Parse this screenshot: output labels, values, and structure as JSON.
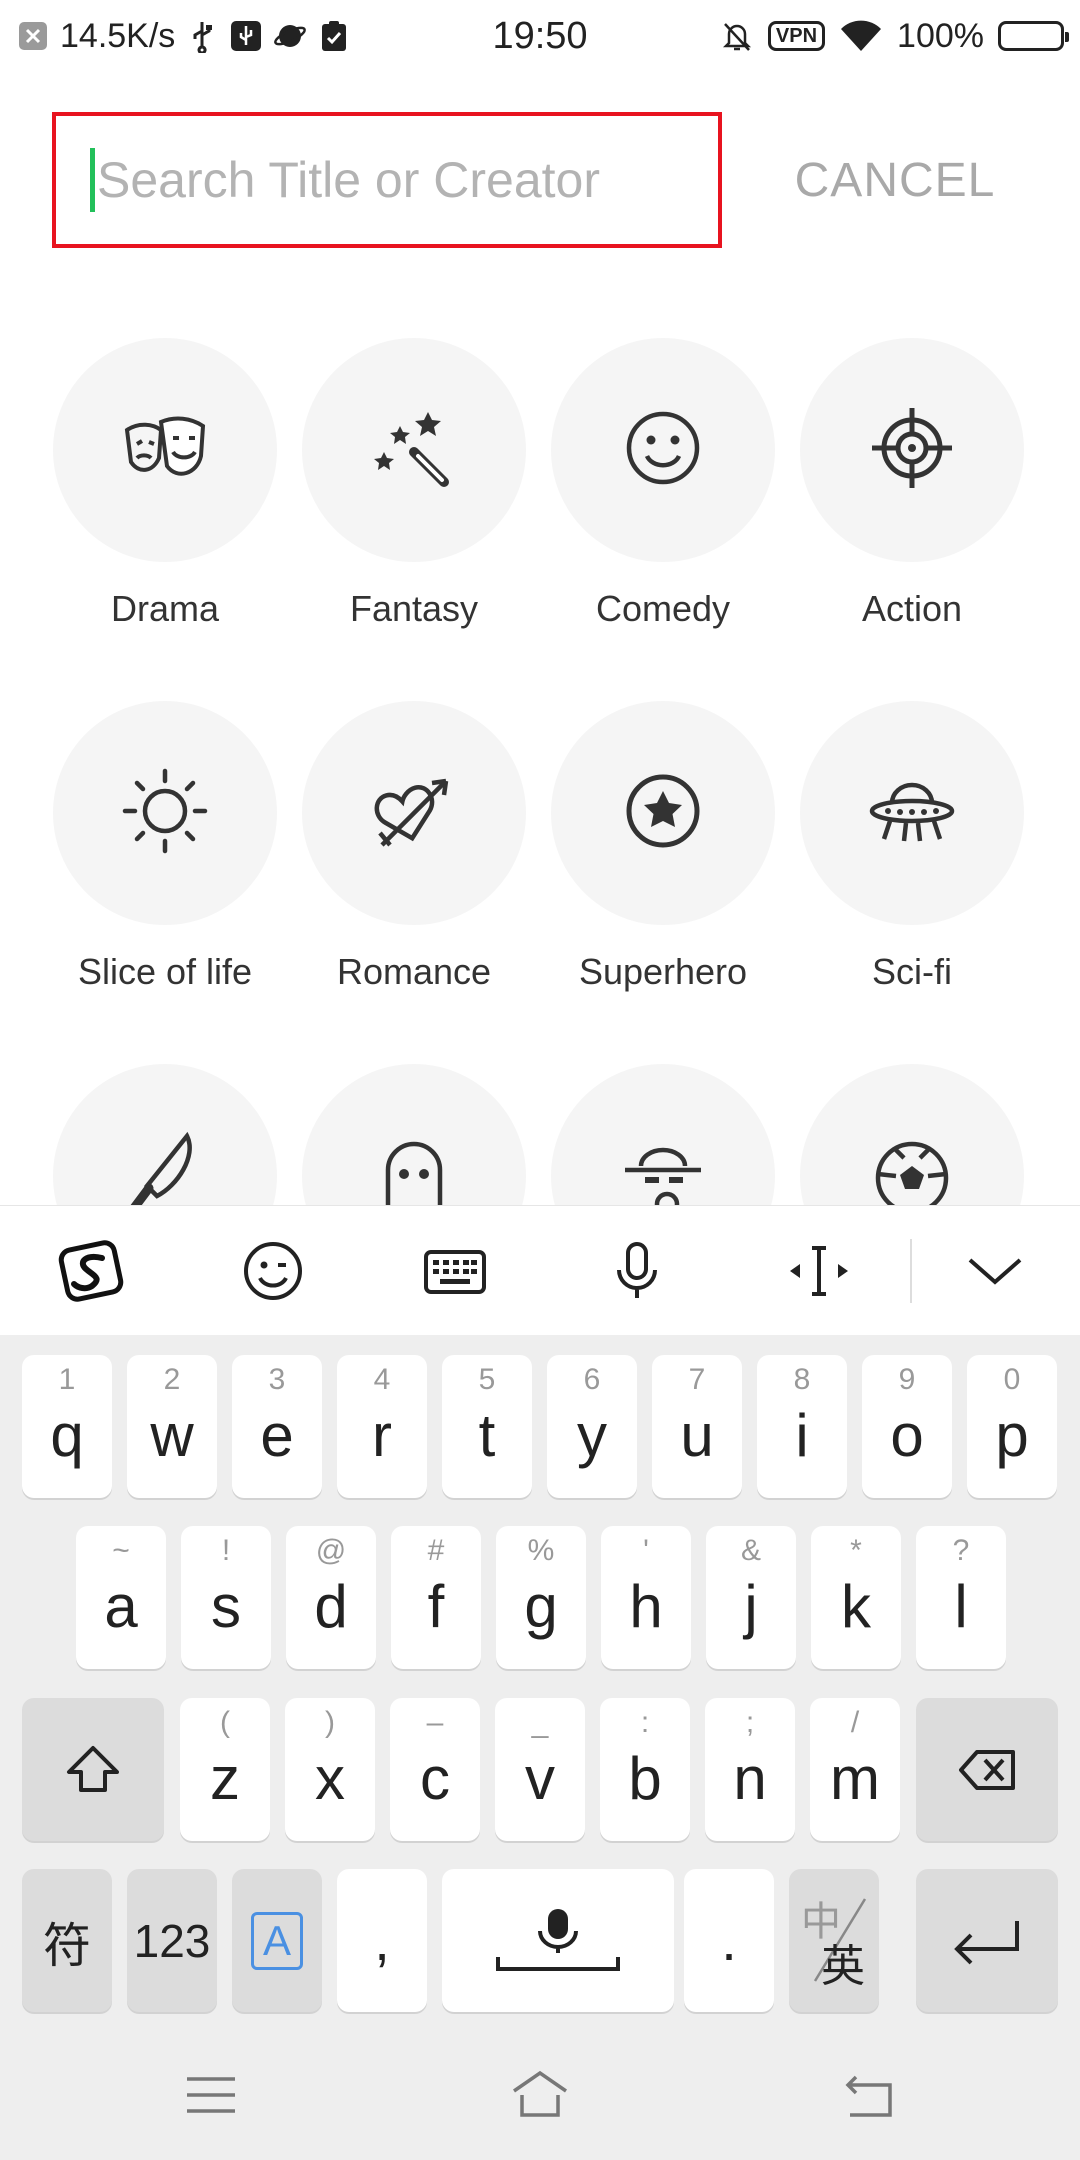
{
  "status_bar": {
    "net_speed": "14.5K/s",
    "time": "19:50",
    "vpn": "VPN",
    "battery": "100%"
  },
  "search": {
    "placeholder": "Search Title or Creator",
    "value": "",
    "cancel_label": "CANCEL"
  },
  "genres": [
    {
      "label": "Drama",
      "icon": "drama-masks-icon"
    },
    {
      "label": "Fantasy",
      "icon": "magic-wand-icon"
    },
    {
      "label": "Comedy",
      "icon": "smiley-icon"
    },
    {
      "label": "Action",
      "icon": "crosshair-icon"
    },
    {
      "label": "Slice of life",
      "icon": "sun-icon"
    },
    {
      "label": "Romance",
      "icon": "heart-arrow-icon"
    },
    {
      "label": "Superhero",
      "icon": "star-badge-icon"
    },
    {
      "label": "Sci-fi",
      "icon": "ufo-icon"
    },
    {
      "label": "",
      "icon": "knife-icon"
    },
    {
      "label": "",
      "icon": "ghost-icon"
    },
    {
      "label": "",
      "icon": "detective-icon"
    },
    {
      "label": "",
      "icon": "soccer-ball-icon"
    }
  ],
  "keyboard": {
    "toolbar": [
      "sogou-logo-icon",
      "emoji-icon",
      "keyboard-icon",
      "microphone-icon",
      "cursor-move-icon",
      "chevron-down-icon"
    ],
    "row1": [
      {
        "hint": "1",
        "key": "q"
      },
      {
        "hint": "2",
        "key": "w"
      },
      {
        "hint": "3",
        "key": "e"
      },
      {
        "hint": "4",
        "key": "r"
      },
      {
        "hint": "5",
        "key": "t"
      },
      {
        "hint": "6",
        "key": "y"
      },
      {
        "hint": "7",
        "key": "u"
      },
      {
        "hint": "8",
        "key": "i"
      },
      {
        "hint": "9",
        "key": "o"
      },
      {
        "hint": "0",
        "key": "p"
      }
    ],
    "row2": [
      {
        "hint": "~",
        "key": "a"
      },
      {
        "hint": "!",
        "key": "s"
      },
      {
        "hint": "@",
        "key": "d"
      },
      {
        "hint": "#",
        "key": "f"
      },
      {
        "hint": "%",
        "key": "g"
      },
      {
        "hint": "'",
        "key": "h"
      },
      {
        "hint": "&",
        "key": "j"
      },
      {
        "hint": "*",
        "key": "k"
      },
      {
        "hint": "?",
        "key": "l"
      }
    ],
    "row3": [
      {
        "hint": "(",
        "key": "z"
      },
      {
        "hint": ")",
        "key": "x"
      },
      {
        "hint": "–",
        "key": "c"
      },
      {
        "hint": "_",
        "key": "v"
      },
      {
        "hint": ":",
        "key": "b"
      },
      {
        "hint": ";",
        "key": "n"
      },
      {
        "hint": "/",
        "key": "m"
      }
    ],
    "symbols_label": "符",
    "numbers_label": "123",
    "case_label": "A",
    "comma_label": ",",
    "period_label": ".",
    "lang_zh": "中",
    "lang_en": "英"
  },
  "colors": {
    "search_border": "#e8131f",
    "caret": "#22c05a",
    "circle_bg": "#f5f5f5",
    "keyboard_bg": "#eeeeee",
    "case_key_accent": "#4a90e2"
  }
}
